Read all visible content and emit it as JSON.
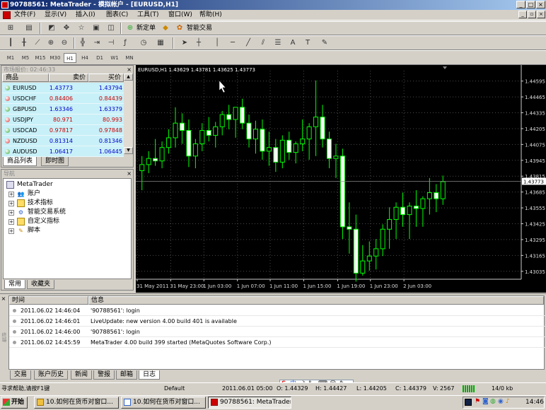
{
  "window": {
    "title": "90788561: MetaTrader - 模拟帐户 - [EURUSD,H1]"
  },
  "menu": [
    "文件(F)",
    "显示(V)",
    "插入(I)",
    "图表(C)",
    "工具(T)",
    "窗口(W)",
    "帮助(H)"
  ],
  "toolbar": {
    "new_order": "新定单",
    "expert_advisors": "智能交易"
  },
  "timeframes": [
    "M1",
    "M5",
    "M15",
    "M30",
    "H1",
    "H4",
    "D1",
    "W1",
    "MN"
  ],
  "market_watch": {
    "title": "市场报价: 02:46:33",
    "col_symbol": "商品",
    "col_bid": "卖价",
    "col_ask": "买价",
    "rows": [
      {
        "symbol": "EURUSD",
        "bid": "1.43773",
        "ask": "1.43794",
        "color": "#0000cc"
      },
      {
        "symbol": "USDCHF",
        "bid": "0.84406",
        "ask": "0.84439",
        "color": "#cc0000"
      },
      {
        "symbol": "GBPUSD",
        "bid": "1.63346",
        "ask": "1.63379",
        "color": "#0000cc"
      },
      {
        "symbol": "USDJPY",
        "bid": "80.971",
        "ask": "80.993",
        "color": "#cc0000"
      },
      {
        "symbol": "USDCAD",
        "bid": "0.97817",
        "ask": "0.97848",
        "color": "#cc0000"
      },
      {
        "symbol": "NZDUSD",
        "bid": "0.81314",
        "ask": "0.81346",
        "color": "#0000cc"
      },
      {
        "symbol": "AUDUSD",
        "bid": "1.06417",
        "ask": "1.06445",
        "color": "#0000cc"
      }
    ],
    "tabs": [
      "商品列表",
      "即时图"
    ]
  },
  "navigator": {
    "title": "导航",
    "root": "MetaTrader",
    "items": [
      "账户",
      "技术指标",
      "智能交易系统",
      "自定义指标",
      "脚本"
    ],
    "tabs": [
      "常用",
      "收藏夹"
    ]
  },
  "chart_data": {
    "type": "candlestick",
    "title": "EURUSD,H1  1.43629 1.43781 1.43625 1.43773",
    "current_price": "1.43773",
    "ylim": [
      1.4297,
      1.4468
    ],
    "y_ticks": [
      "1.44595",
      "1.44465",
      "1.44335",
      "1.44205",
      "1.44075",
      "1.43945",
      "1.43815",
      "1.43685",
      "1.43555",
      "1.43425",
      "1.43295",
      "1.43165",
      "1.43035"
    ],
    "x_labels": [
      "31 May 2011",
      "31 May 23:00",
      "1 Jun 03:00",
      "1 Jun 07:00",
      "1 Jun 11:00",
      "1 Jun 15:00",
      "1 Jun 19:00",
      "1 Jun 23:00",
      "2 Jun 03:00"
    ],
    "candles": [
      [
        1.4386,
        1.4398,
        1.437,
        1.4391
      ],
      [
        1.4391,
        1.4402,
        1.4384,
        1.4396
      ],
      [
        1.4396,
        1.4412,
        1.439,
        1.4394
      ],
      [
        1.4394,
        1.441,
        1.4388,
        1.4405
      ],
      [
        1.4405,
        1.442,
        1.44,
        1.4413
      ],
      [
        1.4413,
        1.4438,
        1.4405,
        1.4425
      ],
      [
        1.4425,
        1.4433,
        1.4408,
        1.4419
      ],
      [
        1.4419,
        1.4428,
        1.4389,
        1.4398
      ],
      [
        1.4398,
        1.4412,
        1.4388,
        1.4408
      ],
      [
        1.4408,
        1.4425,
        1.4402,
        1.4419
      ],
      [
        1.4419,
        1.443,
        1.441,
        1.4415
      ],
      [
        1.4415,
        1.4426,
        1.4405,
        1.4422
      ],
      [
        1.4422,
        1.4435,
        1.4415,
        1.4432
      ],
      [
        1.4432,
        1.444,
        1.442,
        1.4428
      ],
      [
        1.4428,
        1.4437,
        1.4413,
        1.4438
      ],
      [
        1.4438,
        1.4445,
        1.442,
        1.4425
      ],
      [
        1.4425,
        1.4432,
        1.4405,
        1.4412
      ],
      [
        1.4412,
        1.4427,
        1.44,
        1.442
      ],
      [
        1.442,
        1.4428,
        1.4395,
        1.4402
      ],
      [
        1.4402,
        1.4418,
        1.439,
        1.4405
      ],
      [
        1.4405,
        1.4412,
        1.4385,
        1.4393
      ],
      [
        1.4393,
        1.4415,
        1.4388,
        1.4411
      ],
      [
        1.4411,
        1.4418,
        1.4395,
        1.4401
      ],
      [
        1.4401,
        1.441,
        1.4392,
        1.4408
      ],
      [
        1.4408,
        1.4428,
        1.4402,
        1.4412
      ],
      [
        1.4412,
        1.4425,
        1.4395,
        1.4422
      ],
      [
        1.4422,
        1.446,
        1.4398,
        1.443
      ],
      [
        1.443,
        1.444,
        1.4405,
        1.4412
      ],
      [
        1.4412,
        1.4418,
        1.4388,
        1.4396
      ],
      [
        1.4396,
        1.4408,
        1.438,
        1.4398
      ],
      [
        1.4398,
        1.4404,
        1.433,
        1.434
      ],
      [
        1.434,
        1.436,
        1.4318,
        1.4338
      ],
      [
        1.4338,
        1.435,
        1.4295,
        1.4302
      ],
      [
        1.4302,
        1.4325,
        1.43,
        1.4312
      ],
      [
        1.4312,
        1.4328,
        1.4304,
        1.4316
      ],
      [
        1.4316,
        1.433,
        1.4305,
        1.4322
      ],
      [
        1.4322,
        1.4342,
        1.4316,
        1.4338
      ],
      [
        1.4338,
        1.4356,
        1.4322,
        1.4346
      ],
      [
        1.4346,
        1.436,
        1.433,
        1.4356
      ],
      [
        1.4356,
        1.4368,
        1.434,
        1.435
      ],
      [
        1.435,
        1.436,
        1.433,
        1.4357
      ],
      [
        1.4357,
        1.437,
        1.434,
        1.4355
      ],
      [
        1.4355,
        1.4365,
        1.434,
        1.4363
      ],
      [
        1.4363,
        1.438,
        1.435,
        1.4368
      ],
      [
        1.4368,
        1.4375,
        1.4352,
        1.4363
      ],
      [
        1.4363,
        1.4382,
        1.4358,
        1.4377
      ]
    ]
  },
  "terminal": {
    "col_time": "时间",
    "col_message": "信息",
    "rows": [
      {
        "time": "2011.06.02 14:46:04",
        "message": "'90788561': login"
      },
      {
        "time": "2011.06.02 14:46:01",
        "message": "LiveUpdate: new version 4.00 build 401 is available"
      },
      {
        "time": "2011.06.02 14:46:00",
        "message": "'90788561': login"
      },
      {
        "time": "2011.06.02 14:45:59",
        "message": "MetaTrader 4.00 build 399 started (MetaQuotes Software Corp.)"
      }
    ],
    "tabs": [
      "交易",
      "账户历史",
      "新闻",
      "警报",
      "邮箱",
      "日志"
    ],
    "side_label": "终端"
  },
  "status": {
    "help": "寻求帮助,请按F1键",
    "profile": "Default",
    "datetime": "2011.06.01 05:00",
    "open": "O: 1.44329",
    "high": "H: 1.44427",
    "low": "L: 1.44205",
    "close": "C: 1.44379",
    "volume": "V: 2567",
    "traffic": "14/0 kb"
  },
  "taskbar": {
    "start": "开始",
    "tasks": [
      "10.如何在货币对窗口...",
      "10.如何在货币对窗口...",
      "90788561: MetaTrader -..."
    ],
    "clock": "14:46"
  }
}
